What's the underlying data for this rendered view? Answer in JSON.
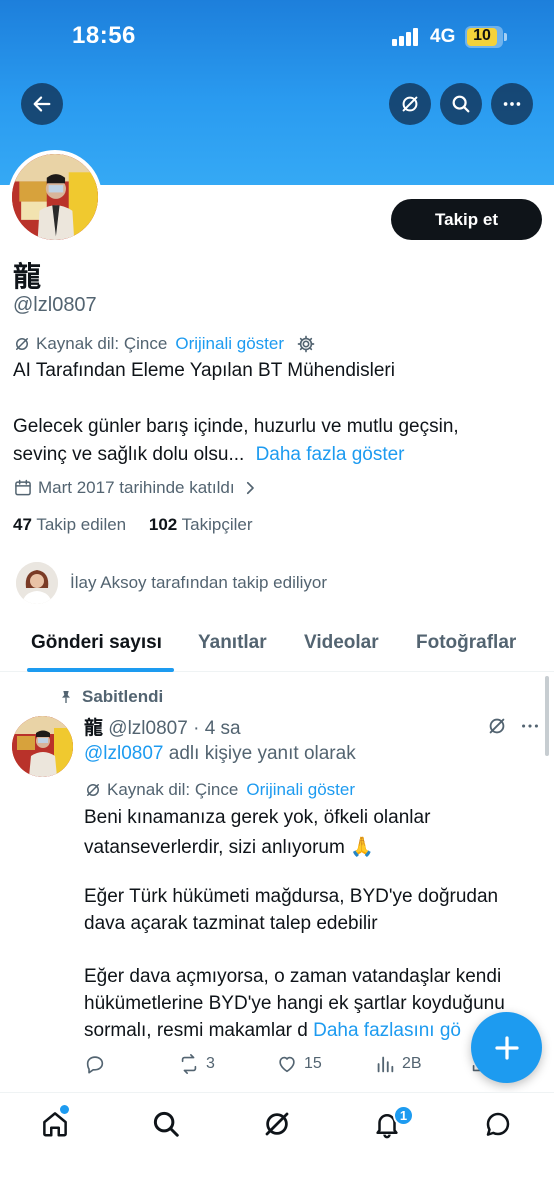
{
  "status_bar": {
    "time": "18:56",
    "network": "4G",
    "battery": "10"
  },
  "profile": {
    "name": "龍",
    "handle": "@lzl0807",
    "follow_label": "Takip et",
    "source_language": "Kaynak dil: Çince",
    "show_original": "Orijinali göster",
    "bio_line1": "AI Tarafından Eleme Yapılan BT Mühendisleri",
    "bio_line2": "Gelecek günler barış içinde, huzurlu ve mutlu geçsin,",
    "bio_line3": "sevinç ve sağlık dolu olsu...",
    "show_more": "Daha fazla göster",
    "joined": "Mart 2017 tarihinde katıldı",
    "following_count": "47",
    "following_label": "Takip edilen",
    "followers_count": "102",
    "followers_label": "Takipçiler",
    "followed_by": "İlay Aksoy tarafından takip ediliyor"
  },
  "tabs": [
    {
      "label": "Gönderi sayısı",
      "active": true
    },
    {
      "label": "Yanıtlar",
      "active": false
    },
    {
      "label": "Videolar",
      "active": false
    },
    {
      "label": "Fotoğraflar",
      "active": false
    }
  ],
  "post": {
    "pinned_label": "Sabitlendi",
    "author_name": "龍",
    "author_handle": "@lzl0807",
    "separator": "·",
    "time": "4 sa",
    "reply_handle": "@lzl0807",
    "reply_suffix": "adlı kişiye yanıt olarak",
    "source_language": "Kaynak dil: Çince",
    "show_original": "Orijinali göster",
    "lines": [
      "Beni kınamanıza gerek yok, öfkeli olanlar",
      "vatanseverlerdir, sizi anlıyorum 🙏",
      "Eğer Türk hükümeti mağdursa, BYD'ye doğrudan",
      "dava açarak tazminat talep edebilir",
      "Eğer dava açmıyorsa, o zaman vatandaşlar kendi",
      "hükümetlerine BYD'ye hangi ek şartlar koyduğunu",
      "sormalı, resmi makamlar d"
    ],
    "show_more": "Daha fazlasını gö",
    "reposts": "3",
    "likes": "15",
    "views": "2B"
  },
  "bottom_nav": {
    "notifications_badge": "1"
  },
  "colors": {
    "accent": "#1d9bf0",
    "text": "#0f1419",
    "muted": "#536471",
    "banner": "#2a9bf0"
  },
  "icons": [
    "back-arrow-icon",
    "grok-icon",
    "search-icon",
    "more-icon",
    "gear-icon",
    "calendar-icon",
    "chevron-right-icon",
    "pin-icon",
    "reply-icon",
    "repost-icon",
    "like-icon",
    "views-icon",
    "share-icon",
    "compose-icon",
    "home-icon",
    "bell-icon",
    "messages-icon"
  ]
}
